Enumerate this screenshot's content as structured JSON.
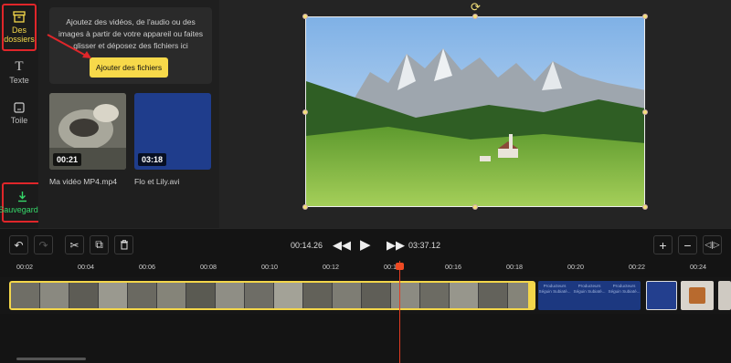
{
  "sidebar": {
    "folders_label": "Des\ndossiers",
    "text_label": "Texte",
    "canvas_label": "Toile",
    "save_label": "Sauvegarder"
  },
  "media": {
    "drop_text": "Ajoutez des vidéos, de l'audio ou des images à partir de votre appareil ou faites glisser et déposez des fichiers ici",
    "add_button": "Ajouter des fichiers",
    "files": [
      {
        "name": "Ma vidéo MP4.mp4",
        "duration": "00:21"
      },
      {
        "name": "Flo et Lily.avi",
        "duration": "03:18"
      }
    ]
  },
  "player": {
    "current_time": "00:14.26",
    "total_time": "03:37.12"
  },
  "ruler": {
    "ticks": [
      "00:02",
      "00:04",
      "00:06",
      "00:08",
      "00:10",
      "00:12",
      "00:14",
      "00:16",
      "00:18",
      "00:20",
      "00:22",
      "00:24"
    ]
  },
  "track": {
    "blue_clip_text": "Producteurs Séguin Subiaté..."
  },
  "colors": {
    "accent_yellow": "#f7d94a",
    "highlight_red": "#e0262a",
    "save_green": "#36d86a",
    "playhead": "#e23c22"
  }
}
